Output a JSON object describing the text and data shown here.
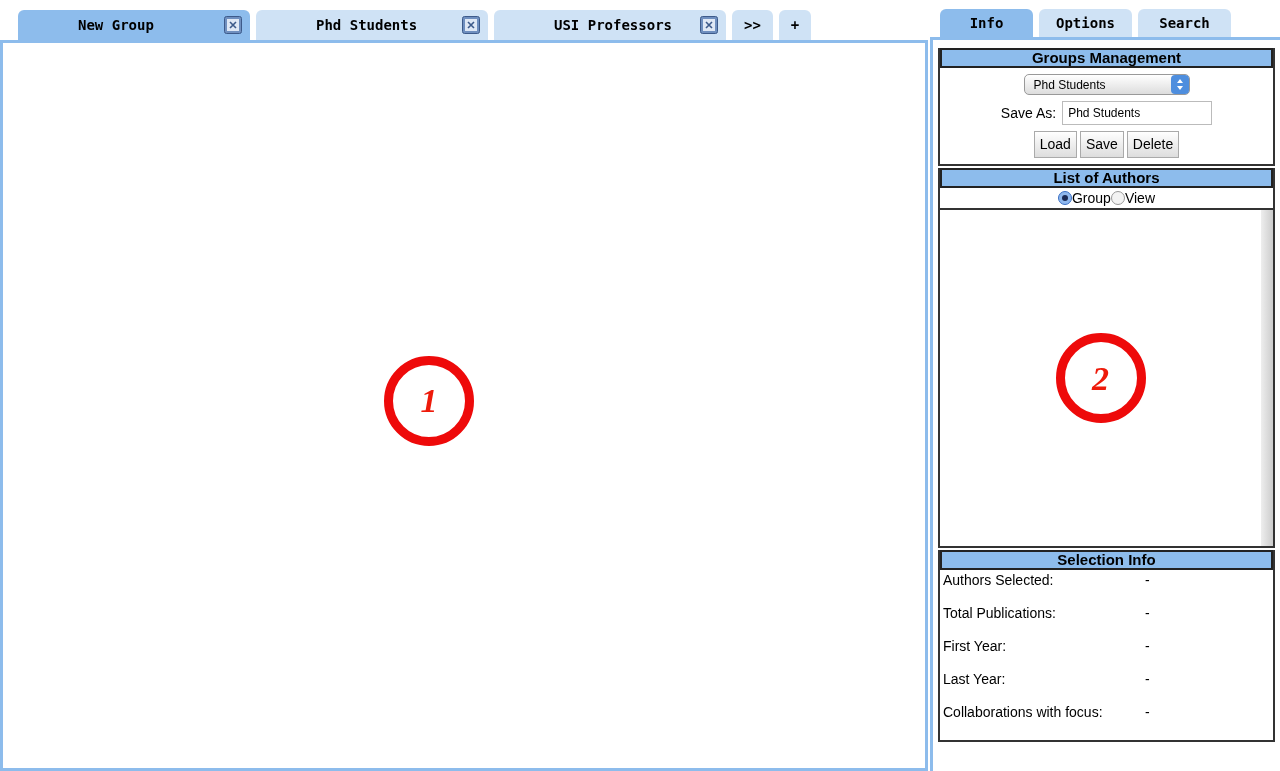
{
  "group_tabs": [
    {
      "label": "New Group",
      "selected": true,
      "closable": true
    },
    {
      "label": "Phd Students",
      "selected": false,
      "closable": true
    },
    {
      "label": "USI Professors",
      "selected": false,
      "closable": true
    },
    {
      "label": ">>",
      "selected": false,
      "closable": false
    },
    {
      "label": "+",
      "selected": false,
      "closable": false
    }
  ],
  "side_tabs": [
    {
      "label": "Info",
      "selected": true
    },
    {
      "label": "Options",
      "selected": false
    },
    {
      "label": "Search",
      "selected": false
    }
  ],
  "canvas_marker": "1",
  "groups_management": {
    "title": "Groups Management",
    "dropdown": "Phd Students",
    "save_as_label": "Save As:",
    "save_as_value": "Phd Students",
    "buttons": [
      "Load",
      "Save",
      "Delete"
    ]
  },
  "authors": {
    "title": "List of Authors",
    "options": [
      {
        "label": "Group",
        "selected": true
      },
      {
        "label": "View",
        "selected": false
      }
    ],
    "marker": "2"
  },
  "selection_info": {
    "title": "Selection Info",
    "rows": [
      {
        "label": "Authors Selected:",
        "value": "-"
      },
      {
        "label": "Total Publications:",
        "value": "-"
      },
      {
        "label": "First Year:",
        "value": "-"
      },
      {
        "label": "Last Year:",
        "value": "-"
      },
      {
        "label": "Collaborations with focus:",
        "value": "-"
      }
    ]
  }
}
